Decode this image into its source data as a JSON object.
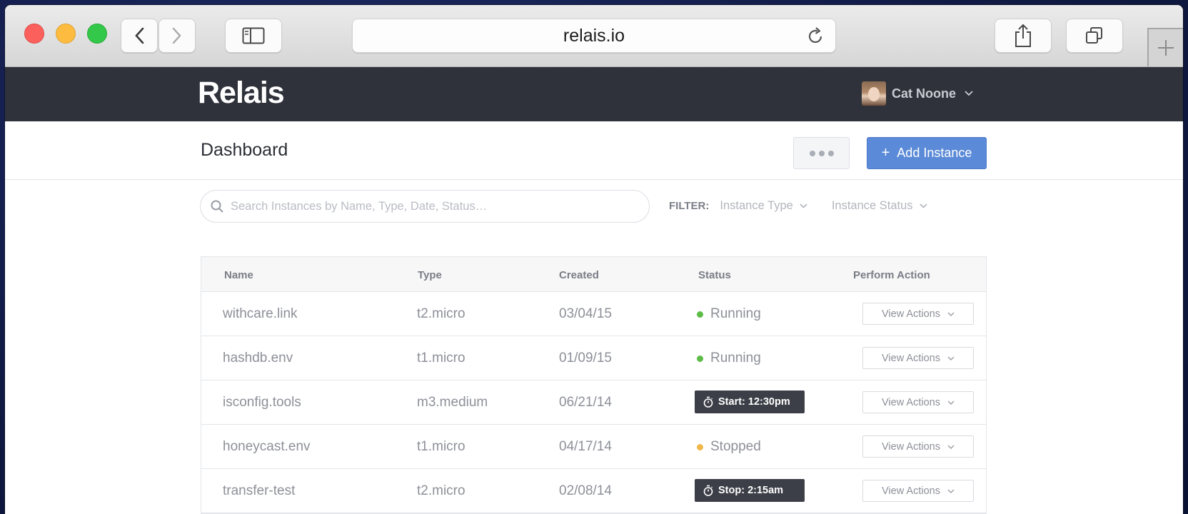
{
  "browser": {
    "url": "relais.io"
  },
  "app": {
    "logo": "Relais",
    "user_name": "Cat Noone"
  },
  "page": {
    "title": "Dashboard",
    "add_button_label": "Add Instance",
    "add_button_icon": "+"
  },
  "search": {
    "placeholder": "Search Instances by Name, Type, Date, Status…"
  },
  "filter": {
    "label": "FILTER:",
    "instance_type": "Instance Type",
    "instance_status": "Instance Status"
  },
  "table": {
    "headers": {
      "name": "Name",
      "type": "Type",
      "created": "Created",
      "status": "Status",
      "action": "Perform Action"
    },
    "action_label": "View Actions",
    "rows": [
      {
        "name": "withcare.link",
        "type": "t2.micro",
        "created": "03/04/15",
        "status": "Running",
        "status_kind": "dot",
        "status_color": "#5dbb46"
      },
      {
        "name": "hashdb.env",
        "type": "t1.micro",
        "created": "01/09/15",
        "status": "Running",
        "status_kind": "dot",
        "status_color": "#5dbb46"
      },
      {
        "name": "isconfig.tools",
        "type": "m3.medium",
        "created": "06/21/14",
        "status": "Start: 12:30pm",
        "status_kind": "timer",
        "status_color": "#3c3f47"
      },
      {
        "name": "honeycast.env",
        "type": "t1.micro",
        "created": "04/17/14",
        "status": "Stopped",
        "status_kind": "dot",
        "status_color": "#f0b84a"
      },
      {
        "name": "transfer-test",
        "type": "t2.micro",
        "created": "02/08/14",
        "status": "Stop: 2:15am",
        "status_kind": "timer",
        "status_color": "#3c3f47"
      }
    ]
  },
  "colors": {
    "accent": "#5b8ad8",
    "header_bg": "#2f323a",
    "running": "#5dbb46",
    "stopped": "#f0b84a"
  }
}
